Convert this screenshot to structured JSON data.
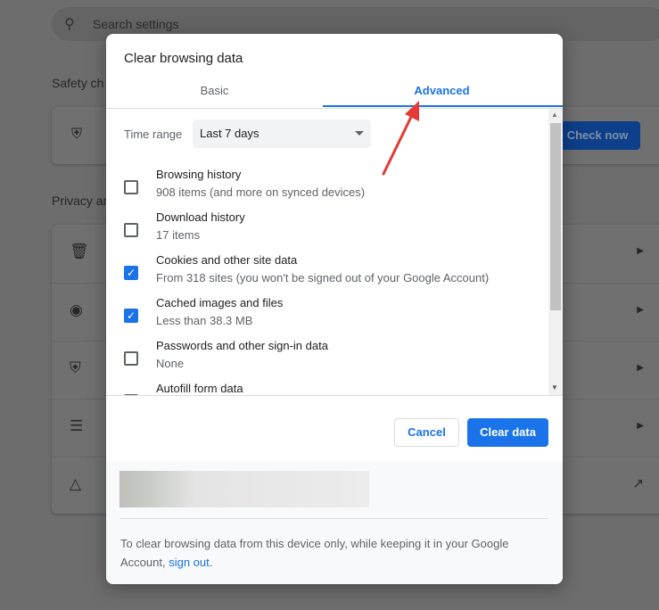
{
  "background": {
    "search_placeholder": "Search settings",
    "safety_heading": "Safety ch",
    "privacy_heading": "Privacy ar",
    "check_now": "Check now"
  },
  "dialog": {
    "title": "Clear browsing data",
    "tabs": [
      {
        "label": "Basic",
        "active": false
      },
      {
        "label": "Advanced",
        "active": true
      }
    ],
    "time_range_label": "Time range",
    "time_range_value": "Last 7 days",
    "items": [
      {
        "title": "Browsing history",
        "subtitle": "908 items (and more on synced devices)",
        "checked": false
      },
      {
        "title": "Download history",
        "subtitle": "17 items",
        "checked": false
      },
      {
        "title": "Cookies and other site data",
        "subtitle": "From 318 sites (you won't be signed out of your Google Account)",
        "checked": true
      },
      {
        "title": "Cached images and files",
        "subtitle": "Less than 38.3 MB",
        "checked": true
      },
      {
        "title": "Passwords and other sign-in data",
        "subtitle": "None",
        "checked": false
      },
      {
        "title": "Autofill form data",
        "subtitle": "",
        "checked": false
      }
    ],
    "cancel": "Cancel",
    "clear": "Clear data",
    "footer_text": "To clear browsing data from this device only, while keeping it in your Google Account,",
    "footer_link": "sign out",
    "footer_end": "."
  },
  "colors": {
    "accent": "#1a73e8",
    "annotation_arrow": "#e53935"
  }
}
